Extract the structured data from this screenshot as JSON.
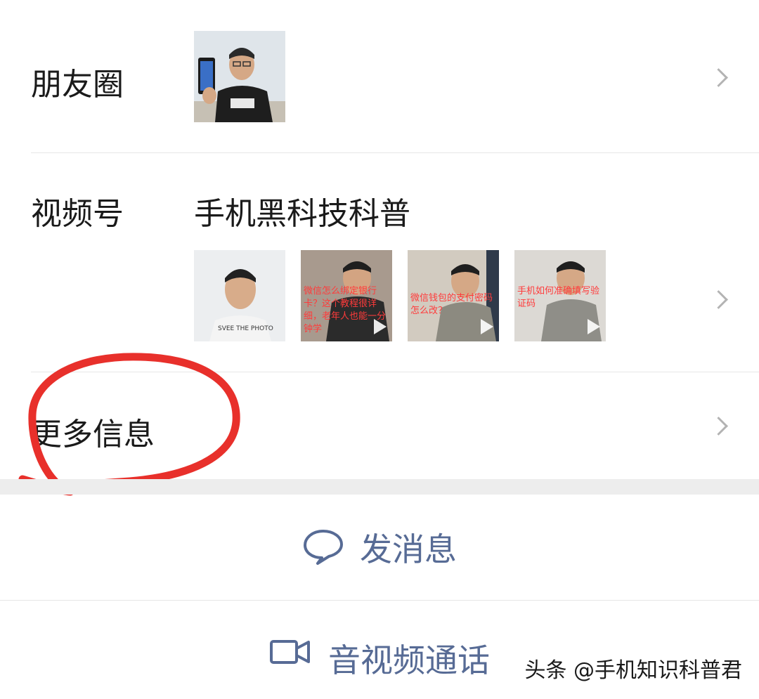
{
  "moments": {
    "label": "朋友圈"
  },
  "channels": {
    "label": "视频号",
    "name": "手机黑科技科普",
    "thumbs": [
      {
        "caption": "",
        "bg": "#e9ecef"
      },
      {
        "caption": "微信怎么绑定银行卡？这个教程很详细，老年人也能一分钟学",
        "bg": "#b9a99e"
      },
      {
        "caption": "微信钱包的支付密码怎么改？",
        "bg": "#c8c1b6"
      },
      {
        "caption": "手机如何准确填写验证码",
        "bg": "#d8d5d0"
      }
    ]
  },
  "more_info": {
    "label": "更多信息"
  },
  "actions": {
    "message": "发消息",
    "call": "音视频通话"
  },
  "watermark": "头条 @手机知识科普君",
  "colors": {
    "link": "#576b95",
    "annotation": "#e8302b"
  }
}
